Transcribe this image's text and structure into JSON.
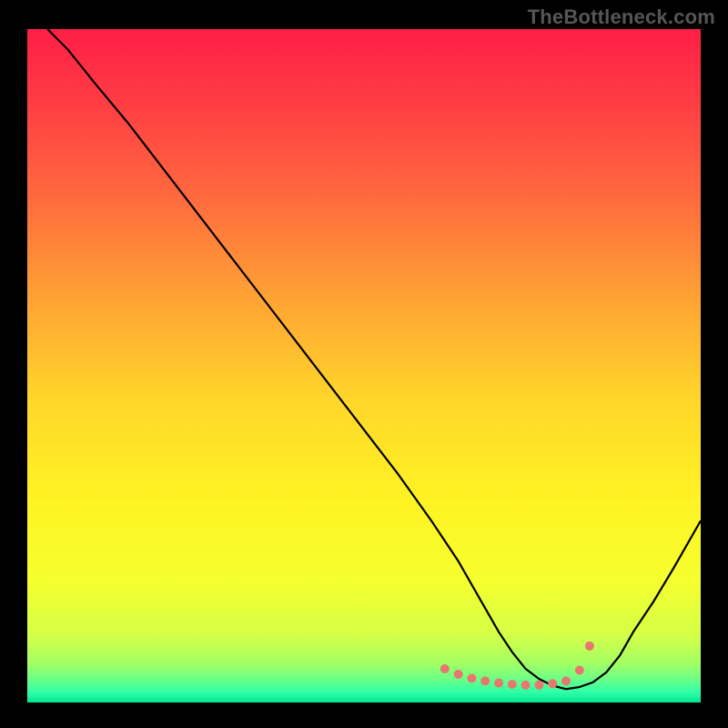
{
  "watermark": "TheBottleneck.com",
  "chart_data": {
    "type": "line",
    "title": "",
    "xlabel": "",
    "ylabel": "",
    "xlim": [
      0,
      100
    ],
    "ylim": [
      0,
      100
    ],
    "background_gradient": {
      "stops": [
        {
          "offset": 0.0,
          "color": "#ff1e46"
        },
        {
          "offset": 0.1,
          "color": "#ff3a44"
        },
        {
          "offset": 0.25,
          "color": "#ff6a3e"
        },
        {
          "offset": 0.4,
          "color": "#ffa334"
        },
        {
          "offset": 0.55,
          "color": "#ffd62a"
        },
        {
          "offset": 0.7,
          "color": "#fff324"
        },
        {
          "offset": 0.82,
          "color": "#f6ff2e"
        },
        {
          "offset": 0.9,
          "color": "#d4ff47"
        },
        {
          "offset": 0.94,
          "color": "#a6ff62"
        },
        {
          "offset": 0.965,
          "color": "#6dff86"
        },
        {
          "offset": 0.985,
          "color": "#2effa8"
        },
        {
          "offset": 1.0,
          "color": "#04e58f"
        }
      ]
    },
    "series": [
      {
        "name": "bottleneck-curve",
        "stroke": "#000000",
        "stroke_width": 2.2,
        "x": [
          3,
          6,
          10,
          15,
          20,
          25,
          30,
          35,
          40,
          45,
          50,
          55,
          60,
          62,
          64,
          66,
          68,
          70,
          72,
          74,
          76,
          78,
          80,
          82,
          84,
          86,
          88,
          90,
          93,
          96,
          100
        ],
        "y": [
          100,
          97,
          92,
          86,
          79.5,
          73,
          66.5,
          60,
          53.5,
          47,
          40.5,
          34,
          27,
          24,
          21,
          17.5,
          14,
          10.5,
          7.5,
          5,
          3.5,
          2.5,
          2,
          2.3,
          3,
          4.5,
          7,
          10.5,
          15,
          20,
          27
        ]
      }
    ],
    "marker_band": {
      "name": "optimal-range-markers",
      "color": "#e8776f",
      "radius": 5,
      "points_x": [
        62,
        64,
        66,
        68,
        70,
        72,
        74,
        76,
        78,
        80,
        82,
        83.5
      ],
      "points_y": [
        5,
        4.2,
        3.6,
        3.2,
        2.9,
        2.7,
        2.6,
        2.6,
        2.8,
        3.2,
        4.8,
        8.4
      ]
    }
  }
}
